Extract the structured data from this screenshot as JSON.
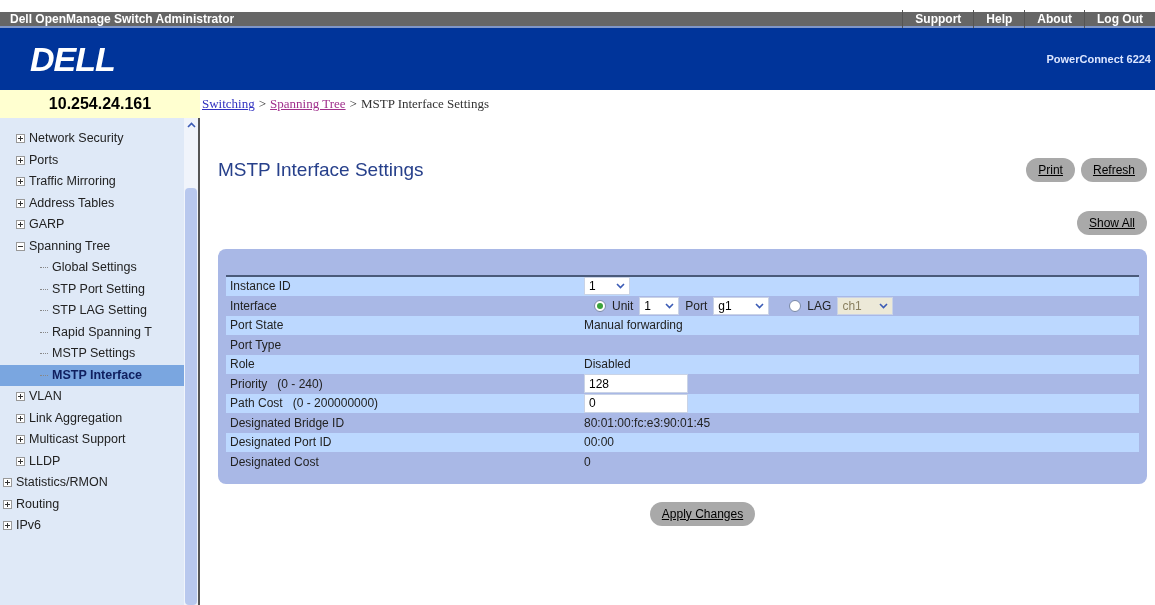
{
  "top_bar": {
    "title": "Dell OpenManage Switch Administrator",
    "links": [
      "Support",
      "Help",
      "About",
      "Log Out"
    ]
  },
  "banner": {
    "logo": "DELL",
    "product": "PowerConnect 6224"
  },
  "ip_address": "10.254.24.161",
  "breadcrumb_separators": [
    ">",
    ">"
  ],
  "breadcrumb": [
    {
      "label": "Switching",
      "kind": "link"
    },
    {
      "label": "Spanning Tree",
      "kind": "visited"
    },
    {
      "label": "MSTP Interface Settings",
      "kind": "text"
    }
  ],
  "sidebar": {
    "items": [
      {
        "label": "Network Security",
        "expanded": false
      },
      {
        "label": "Ports",
        "expanded": false
      },
      {
        "label": "Traffic Mirroring",
        "expanded": false
      },
      {
        "label": "Address Tables",
        "expanded": false
      },
      {
        "label": "GARP",
        "expanded": false
      },
      {
        "label": "Spanning Tree",
        "expanded": true,
        "children": [
          {
            "label": "Global Settings",
            "selected": false
          },
          {
            "label": "STP Port Setting",
            "selected": false
          },
          {
            "label": "STP LAG Setting",
            "selected": false
          },
          {
            "label": "Rapid Spanning T",
            "selected": false
          },
          {
            "label": "MSTP Settings",
            "selected": false
          },
          {
            "label": "MSTP Interface",
            "selected": true
          }
        ]
      },
      {
        "label": "VLAN",
        "expanded": false
      },
      {
        "label": "Link Aggregation",
        "expanded": false
      },
      {
        "label": "Multicast Support",
        "expanded": false
      },
      {
        "label": "LLDP",
        "expanded": false
      }
    ],
    "root_items": [
      {
        "label": "Statistics/RMON",
        "expanded": false
      },
      {
        "label": "Routing",
        "expanded": false
      },
      {
        "label": "IPv6",
        "expanded": false
      }
    ]
  },
  "page_title": "MSTP Interface Settings",
  "header_buttons": [
    "Print",
    "Refresh"
  ],
  "show_all_button": "Show All",
  "rows": [
    {
      "kind": "select",
      "label": "Instance ID",
      "value": "1"
    },
    {
      "kind": "interface",
      "label": "Interface",
      "unit_label": "Unit",
      "unit_selected": true,
      "unit_value": "1",
      "port_label": "Port",
      "port_value": "g1",
      "lag_label": "LAG",
      "lag_selected": false,
      "lag_value": "ch1",
      "lag_disabled": true
    },
    {
      "kind": "text",
      "label": "Port State",
      "value": "Manual forwarding"
    },
    {
      "kind": "text",
      "label": "Port Type"
    },
    {
      "kind": "text",
      "label": "Role",
      "value": "Disabled"
    },
    {
      "kind": "input",
      "label": "Priority",
      "range": "(0 - 240)",
      "value": "128"
    },
    {
      "kind": "input",
      "label": "Path Cost",
      "range": "(0 - 200000000)",
      "value": "0"
    },
    {
      "kind": "text",
      "label": "Designated Bridge ID",
      "value": "80:01:00:fc:e3:90:01:45"
    },
    {
      "kind": "text",
      "label": "Designated Port ID",
      "value": "00:00"
    },
    {
      "kind": "text",
      "label": "Designated Cost",
      "value": "0"
    }
  ],
  "apply_button": "Apply Changes"
}
